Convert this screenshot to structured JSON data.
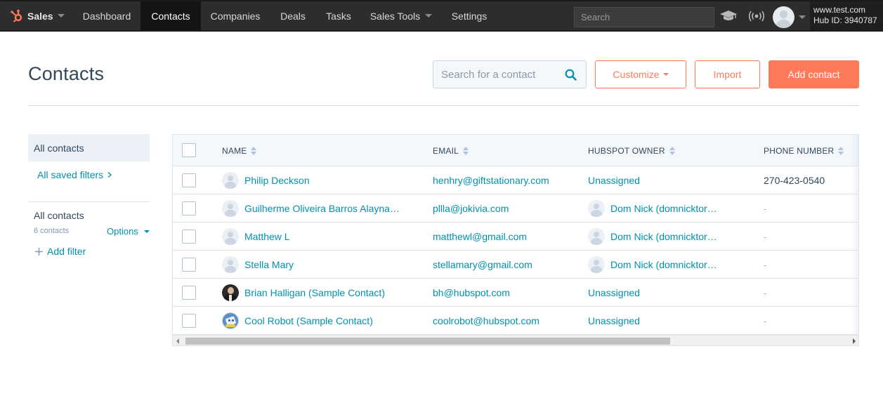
{
  "nav": {
    "brand": "Sales",
    "items": [
      {
        "label": "Dashboard",
        "active": false
      },
      {
        "label": "Contacts",
        "active": true
      },
      {
        "label": "Companies",
        "active": false
      },
      {
        "label": "Deals",
        "active": false
      },
      {
        "label": "Tasks",
        "active": false
      },
      {
        "label": "Sales Tools",
        "active": false,
        "dropdown": true
      },
      {
        "label": "Settings",
        "active": false
      }
    ],
    "search_placeholder": "Search",
    "account_domain": "www.test.com",
    "hub_id": "Hub ID: 3940787"
  },
  "header": {
    "title": "Contacts",
    "search_placeholder": "Search for a contact",
    "customize_label": "Customize",
    "import_label": "Import",
    "add_contact_label": "Add contact"
  },
  "sidebar": {
    "all_contacts_tab": "All contacts",
    "saved_filters_link": "All saved filters",
    "view_label": "All contacts",
    "view_count": "6 contacts",
    "options_label": "Options",
    "add_filter_label": "Add filter"
  },
  "table": {
    "columns": [
      "NAME",
      "EMAIL",
      "HUBSPOT OWNER",
      "PHONE NUMBER"
    ],
    "rows": [
      {
        "name": "Philip Deckson",
        "avatar": "default",
        "email": "henhry@giftstationary.com",
        "owner": "Unassigned",
        "owner_avatar": false,
        "phone": "270-423-0540"
      },
      {
        "name": "Guilherme Oliveira Barros Alayna…",
        "avatar": "default",
        "email": "pllla@jokivia.com",
        "owner": "Dom Nick (domnicktor…",
        "owner_avatar": true,
        "phone": "-"
      },
      {
        "name": "Matthew L",
        "avatar": "default",
        "email": "matthewl@gmail.com",
        "owner": "Dom Nick (domnicktor…",
        "owner_avatar": true,
        "phone": "-"
      },
      {
        "name": "Stella Mary",
        "avatar": "default",
        "email": "stellamary@gmail.com",
        "owner": "Dom Nick (domnicktor…",
        "owner_avatar": true,
        "phone": "-"
      },
      {
        "name": "Brian Halligan (Sample Contact)",
        "avatar": "photo",
        "email": "bh@hubspot.com",
        "owner": "Unassigned",
        "owner_avatar": false,
        "phone": "-"
      },
      {
        "name": "Cool Robot (Sample Contact)",
        "avatar": "robot",
        "email": "coolrobot@hubspot.com",
        "owner": "Unassigned",
        "owner_avatar": false,
        "phone": "-"
      }
    ]
  },
  "colors": {
    "accent": "#ff7a59",
    "link": "#0091ae",
    "text": "#33475b",
    "nav_bg": "#2d2d2d"
  }
}
